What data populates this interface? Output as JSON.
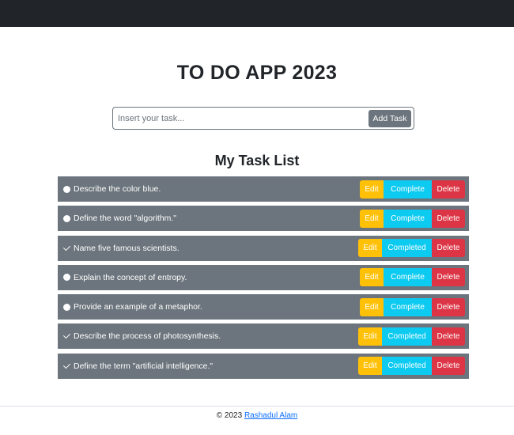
{
  "header": {
    "title": "TO DO APP 2023"
  },
  "form": {
    "placeholder": "Insert your task...",
    "add_label": "Add Task"
  },
  "list": {
    "title": "My Task List",
    "edit_label": "Edit",
    "complete_label": "Complete",
    "completed_label": "Completed",
    "delete_label": "Delete",
    "items": [
      {
        "text": "Describe the color blue.",
        "completed": false
      },
      {
        "text": "Define the word \"algorithm.\"",
        "completed": false
      },
      {
        "text": "Name five famous scientists.",
        "completed": true
      },
      {
        "text": "Explain the concept of entropy.",
        "completed": false
      },
      {
        "text": "Provide an example of a metaphor.",
        "completed": false
      },
      {
        "text": "Describe the process of photosynthesis.",
        "completed": true
      },
      {
        "text": "Define the term \"artificial intelligence.\"",
        "completed": true
      }
    ]
  },
  "footer": {
    "copyright": "© 2023",
    "author": "Rashadul Alam"
  },
  "colors": {
    "navbar": "#212529",
    "row": "#6c757d",
    "edit": "#ffc107",
    "complete": "#0dcaf0",
    "delete": "#dc3545",
    "link": "#0d6efd"
  },
  "icons": {
    "pending": "circle-icon",
    "done": "check-icon"
  }
}
